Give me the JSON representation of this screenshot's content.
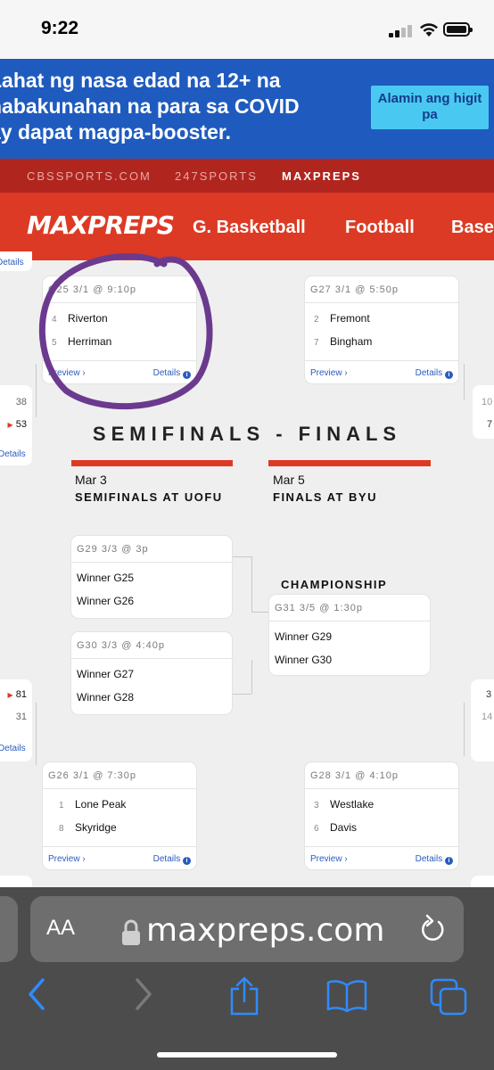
{
  "status": {
    "time": "9:22"
  },
  "ad": {
    "lines": [
      "Lahat ng nasa edad na 12+ na",
      "nabakunahan na para sa COVID",
      "ay dapat magpa-booster."
    ],
    "button": "Alamin ang higit pa"
  },
  "network": {
    "items": [
      "CBSSPORTS.COM",
      "247SPORTS",
      "MAXPREPS"
    ],
    "active": "MAXPREPS"
  },
  "header": {
    "logo": "MAXPREPS",
    "nav": [
      "G. Basketball",
      "Football",
      "Base"
    ]
  },
  "bracket": {
    "edge_top_left": "Details",
    "edge_scores_left": [
      "38",
      "53"
    ],
    "edge_details_mid": "Details",
    "edge_right_scores": [
      "10",
      "7"
    ],
    "games_top": [
      {
        "id": "G25 3/1 @ 9:10p",
        "teams": [
          {
            "seed": "4",
            "name": "Riverton"
          },
          {
            "seed": "5",
            "name": "Herriman"
          }
        ],
        "preview": "Preview ›",
        "details": "Details"
      },
      {
        "id": "G27 3/1 @ 5:50p",
        "teams": [
          {
            "seed": "2",
            "name": "Fremont"
          },
          {
            "seed": "7",
            "name": "Bingham"
          }
        ],
        "preview": "Preview ›",
        "details": "Details"
      }
    ],
    "section_title": "SEMIFINALS - FINALS",
    "semis": {
      "date": "Mar 3",
      "label": "SEMIFINALS AT UOFU"
    },
    "finals": {
      "date": "Mar 5",
      "label": "FINALS AT BYU"
    },
    "semi_games": [
      {
        "id": "G29 3/3 @ 3p",
        "teams": [
          "Winner G25",
          "Winner G26"
        ]
      },
      {
        "id": "G30 3/3 @ 4:40p",
        "teams": [
          "Winner G27",
          "Winner G28"
        ]
      }
    ],
    "championship_label": "CHAMPIONSHIP",
    "final_game": {
      "id": "G31 3/5 @ 1:30p",
      "teams": [
        "Winner G29",
        "Winner G30"
      ]
    },
    "edge_scores_left2": [
      "81",
      "31"
    ],
    "edge_right_scores2": [
      "3",
      "14"
    ],
    "games_bottom": [
      {
        "id": "G26 3/1 @ 7:30p",
        "teams": [
          {
            "seed": "1",
            "name": "Lone Peak"
          },
          {
            "seed": "8",
            "name": "Skyridge"
          }
        ],
        "preview": "Preview ›",
        "details": "Details"
      },
      {
        "id": "G28 3/1 @ 4:10p",
        "teams": [
          {
            "seed": "3",
            "name": "Westlake"
          },
          {
            "seed": "6",
            "name": "Davis"
          }
        ],
        "preview": "Preview ›",
        "details": "Details"
      }
    ]
  },
  "browser": {
    "aa": "AA",
    "url": "maxpreps.com"
  },
  "colors": {
    "brand_red": "#dc3a24",
    "ad_blue": "#1f5bbf",
    "annotation_purple": "#6b3a8e"
  }
}
